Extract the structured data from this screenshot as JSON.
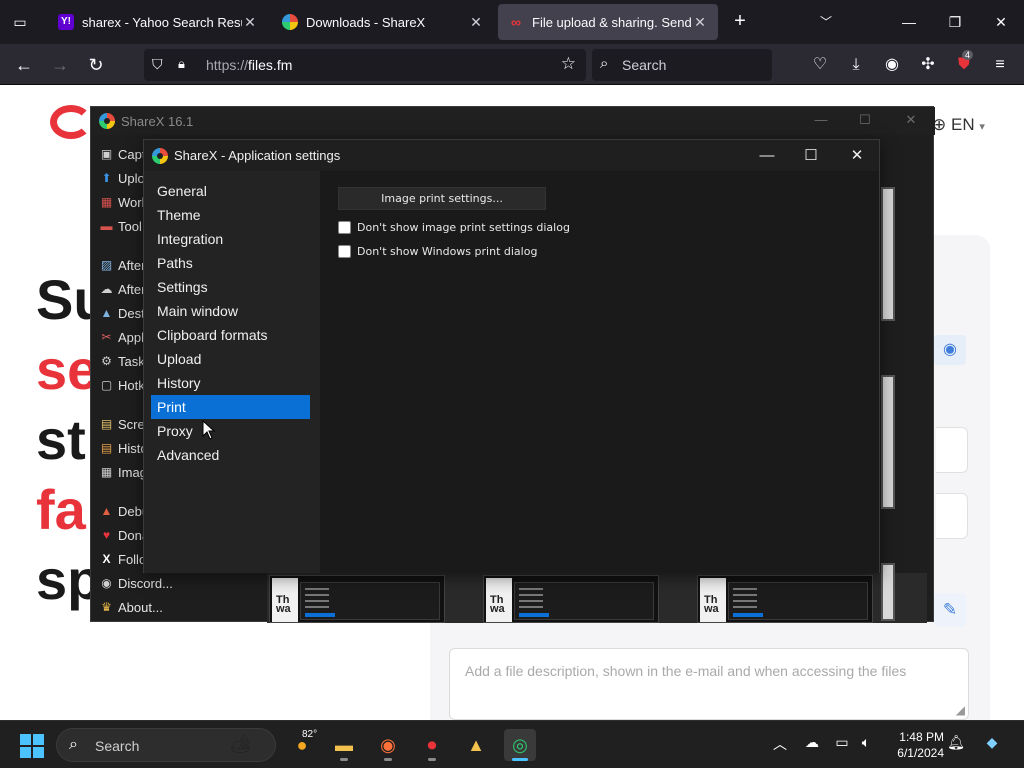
{
  "browser": {
    "tabs": [
      {
        "title": "sharex - Yahoo Search Results",
        "favicon": "Y!",
        "favicon_color": "#6001d2",
        "active": false
      },
      {
        "title": "Downloads - ShareX",
        "favicon": "",
        "favicon_color": "#ffffff",
        "active": false
      },
      {
        "title": "File upload & sharing. Send larg",
        "favicon": "",
        "favicon_color": "#e8333b",
        "active": true
      }
    ],
    "url_scheme": "https://",
    "url_host": "files.fm",
    "search_placeholder": "Search",
    "extension_badge": "4"
  },
  "page": {
    "lang": "EN",
    "hero_lines": [
      {
        "text": "Su",
        "color": "black"
      },
      {
        "text": "se",
        "color": "red"
      },
      {
        "text": "st",
        "color": "black"
      },
      {
        "text": "fa",
        "color": "red"
      },
      {
        "text": "sp",
        "color": "black"
      }
    ],
    "description_placeholder": "Add a file description, shown in the e-mail and when accessing the files"
  },
  "sharex_main": {
    "title": "ShareX 16.1",
    "menu": [
      {
        "label": "Capt",
        "icon": "capture-icon",
        "glyph": "▣",
        "color": "#cfcfcf"
      },
      {
        "label": "Uplo",
        "icon": "upload-icon",
        "glyph": "⬆",
        "color": "#3b8fe0"
      },
      {
        "label": "Work",
        "icon": "workflows-icon",
        "glyph": "▦",
        "color": "#d9534f"
      },
      {
        "label": "Tool",
        "icon": "tools-icon",
        "glyph": "▬",
        "color": "#d9534f"
      },
      {
        "label": "After",
        "icon": "after-capture-icon",
        "glyph": "▨",
        "color": "#7fb3e0"
      },
      {
        "label": "After",
        "icon": "after-upload-icon",
        "glyph": "☁",
        "color": "#cfcfcf"
      },
      {
        "label": "Dest",
        "icon": "destinations-icon",
        "glyph": "▲",
        "color": "#7fb3e0"
      },
      {
        "label": "Appl",
        "icon": "app-settings-icon",
        "glyph": "✂",
        "color": "#e06060"
      },
      {
        "label": "Task",
        "icon": "task-settings-icon",
        "glyph": "⚙",
        "color": "#cfcfcf"
      },
      {
        "label": "Hotk",
        "icon": "hotkey-icon",
        "glyph": "▢",
        "color": "#cfcfcf"
      },
      {
        "label": "Scre",
        "icon": "screenshots-folder-icon",
        "glyph": "▤",
        "color": "#e8c46a"
      },
      {
        "label": "Histo",
        "icon": "history-icon",
        "glyph": "▤",
        "color": "#e8a04a"
      },
      {
        "label": "Imag",
        "icon": "image-history-icon",
        "glyph": "▦",
        "color": "#cfcfcf"
      },
      {
        "label": "Debu",
        "icon": "debug-icon",
        "glyph": "▲",
        "color": "#e06040"
      },
      {
        "label": "Dona",
        "icon": "donate-heart-icon",
        "glyph": "♥",
        "color": "#e8333b"
      },
      {
        "label": "Follo",
        "icon": "x-logo-icon",
        "glyph": "X",
        "color": "#ffffff"
      },
      {
        "label": "Discord...",
        "icon": "discord-icon",
        "glyph": "◉",
        "color": "#cfcfcf"
      },
      {
        "label": "About...",
        "icon": "crown-icon",
        "glyph": "♛",
        "color": "#e8b84a"
      }
    ],
    "thumb_word": "Th wa"
  },
  "settings": {
    "title": "ShareX - Application settings",
    "nav": [
      "General",
      "Theme",
      "Integration",
      "Paths",
      "Settings",
      "Main window",
      "Clipboard formats",
      "Upload",
      "History",
      "Print",
      "Proxy",
      "Advanced"
    ],
    "selected_nav": "Print",
    "print_button": "Image print settings...",
    "checkboxes": [
      {
        "label": "Don't show image print settings dialog",
        "checked": false
      },
      {
        "label": "Don't show Windows print dialog",
        "checked": false
      }
    ]
  },
  "taskbar": {
    "search_placeholder": "Search",
    "weather_temp": "82°",
    "time": "1:48 PM",
    "date": "6/1/2024"
  },
  "colors": {
    "accent_selected": "#0a70d6",
    "brand_red": "#e8333b"
  }
}
